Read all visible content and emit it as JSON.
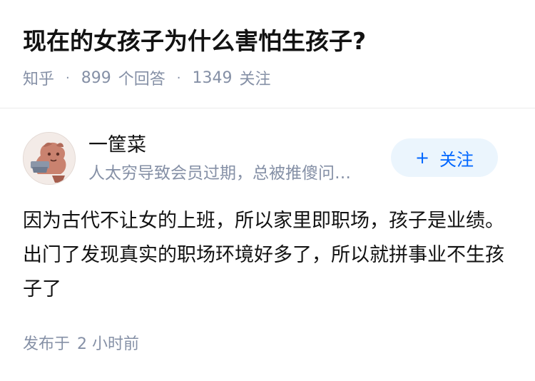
{
  "question": {
    "title": "现在的女孩子为什么害怕生孩子?",
    "source": "知乎",
    "answer_count": "899",
    "answer_label": "个回答",
    "follower_count": "1349",
    "follower_label": "关注",
    "separator": "·"
  },
  "answer": {
    "author": {
      "name": "一筐菜",
      "bio": "人太穷导致会员过期，总被推傻问…"
    },
    "follow_button": {
      "icon": "+",
      "label": "关注"
    },
    "content": "因为古代不让女的上班，所以家里即职场，孩子是业绩。出门了发现真实的职场环境好多了，所以就拼事业不生孩子了",
    "published_label": "发布于",
    "published_time": "2 小时前"
  },
  "colors": {
    "accent": "#0066ff",
    "follow_bg": "#ebf5fd",
    "meta_text": "#8590a6",
    "main_text": "#121212"
  }
}
